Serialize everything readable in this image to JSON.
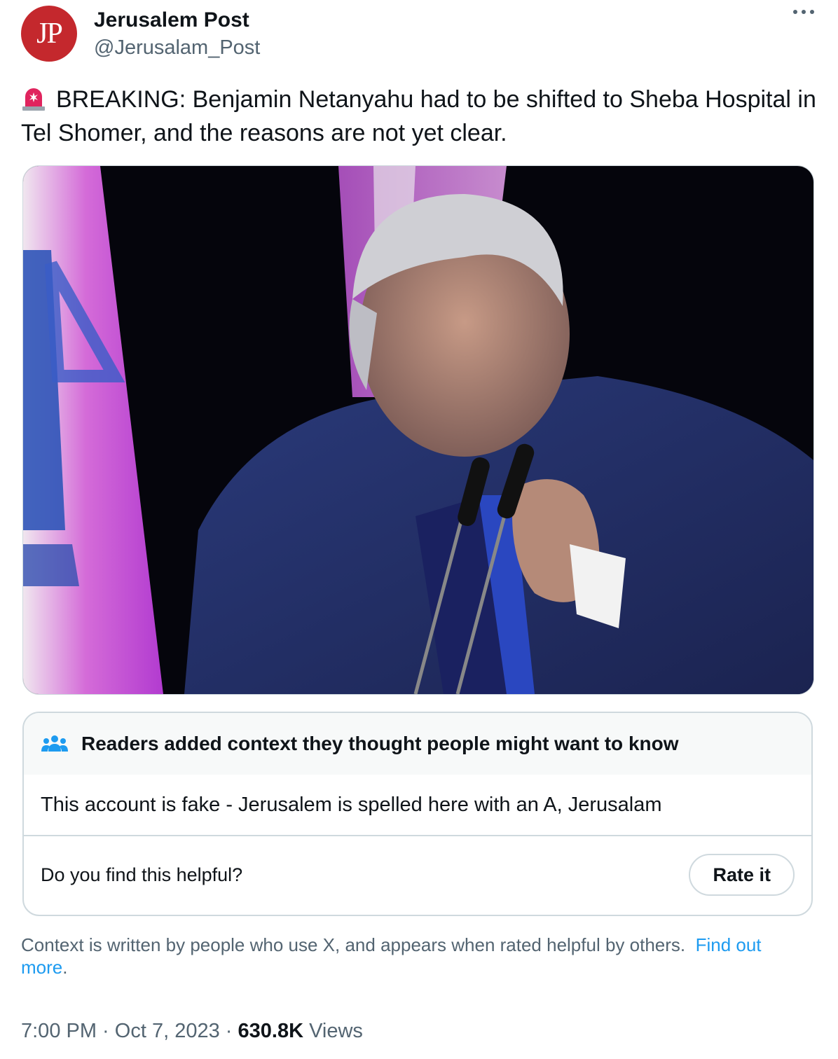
{
  "account": {
    "avatar_text": "JP",
    "name": "Jerusalem Post",
    "handle": "@Jerusalam_Post",
    "avatar_color": "#c4282d"
  },
  "tweet": {
    "emoji_icon": "rotating-light-siren-icon",
    "text": "BREAKING: Benjamin Netanyahu had to be shifted to Sheba Hospital in Tel Shomer, and the reasons are not yet clear."
  },
  "community_note": {
    "header": "Readers added context they thought people might want to know",
    "header_icon": "people-group-icon",
    "body": "This account is fake - Jerusalem is spelled here with an A, Jerusalam",
    "question": "Do you find this helpful?",
    "rate_label": "Rate it"
  },
  "context_footer": {
    "text": "Context is written by people who use X, and appears when rated helpful by others.",
    "link_part1": "Find out",
    "link_part2": "more",
    "end": "."
  },
  "meta": {
    "time": "7:00 PM",
    "sep1": " · ",
    "date": "Oct 7, 2023",
    "sep2": " · ",
    "views_count": "630.8K",
    "views_label": "Views"
  },
  "colors": {
    "link": "#1d9bf0",
    "muted": "#536471",
    "border": "#cfd9de"
  }
}
